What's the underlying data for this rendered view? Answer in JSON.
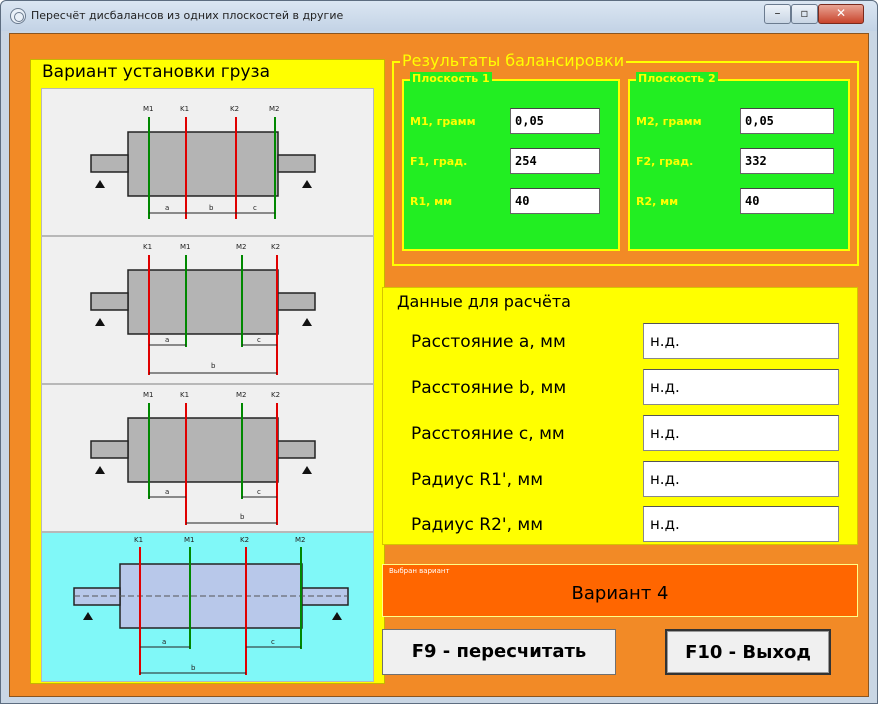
{
  "window": {
    "title": "Пересчёт дисбалансов из одних плоскостей в другие",
    "controls": {
      "minimize": "–",
      "maximize": "▫",
      "close": "✕"
    }
  },
  "left_panel": {
    "title": "Вариант установки груза",
    "variants": [
      {
        "plane_labels": [
          "M1",
          "K1",
          "K2",
          "M2"
        ],
        "dims": [
          "a",
          "b",
          "c"
        ]
      },
      {
        "plane_labels": [
          "K1",
          "M1",
          "M2",
          "K2"
        ],
        "dims": [
          "a",
          "c",
          "b"
        ]
      },
      {
        "plane_labels": [
          "M1",
          "K1",
          "M2",
          "K2"
        ],
        "dims": [
          "a",
          "c",
          "b"
        ]
      },
      {
        "plane_labels": [
          "K1",
          "M1",
          "K2",
          "M2"
        ],
        "dims": [
          "a",
          "c",
          "b"
        ]
      }
    ]
  },
  "results": {
    "title": "Результаты балансировки",
    "plane1": {
      "title": "Плоскость 1",
      "m_label": "M1, грамм",
      "m_value": "0,05",
      "f_label": "F1, град.",
      "f_value": "254",
      "r_label": "R1, мм",
      "r_value": "40"
    },
    "plane2": {
      "title": "Плоскость 2",
      "m_label": "M2, грамм",
      "m_value": "0,05",
      "f_label": "F2, град.",
      "f_value": "332",
      "r_label": "R2, мм",
      "r_value": "40"
    }
  },
  "calc_data": {
    "title": "Данные для расчёта",
    "rows": [
      {
        "label": "Расстояние a, мм",
        "value": "н.д."
      },
      {
        "label": "Расстояние b, мм",
        "value": "н.д."
      },
      {
        "label": "Расстояние c, мм",
        "value": "н.д."
      },
      {
        "label": "Радиус R1', мм",
        "value": "н.д."
      },
      {
        "label": "Радиус R2', мм",
        "value": "н.д."
      }
    ]
  },
  "selected": {
    "caption": "Выбран вариант",
    "value": "Вариант 4"
  },
  "buttons": {
    "recalc": "F9 - пересчитать",
    "exit": "F10 - Выход"
  },
  "colors": {
    "background": "#f28a26",
    "panel_yellow": "#ffff00",
    "plane_green": "#22ee22",
    "selected_orange": "#ff6600",
    "active_variant": "#80f8f8",
    "line_red": "#e00000",
    "line_green": "#008800"
  }
}
